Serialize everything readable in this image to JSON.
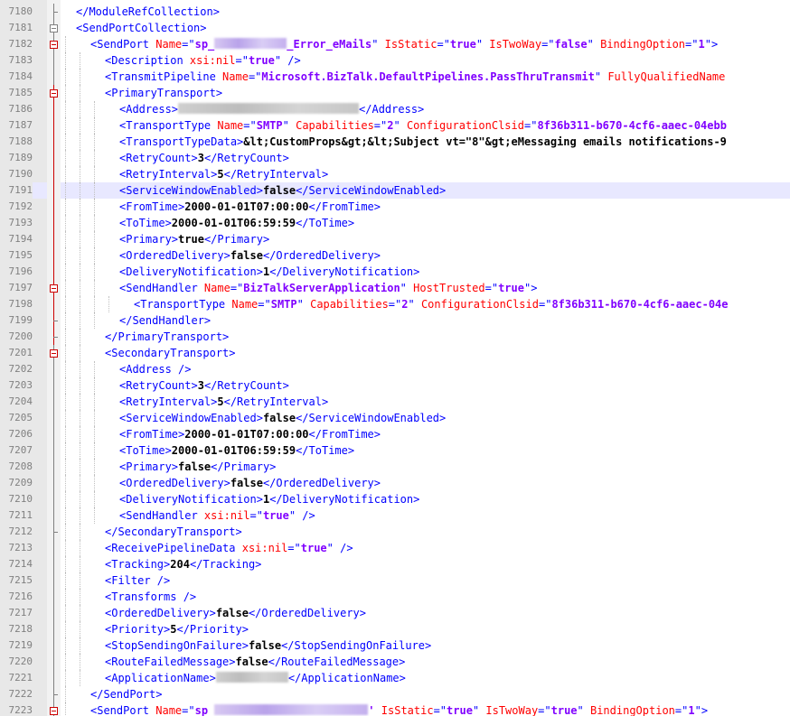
{
  "editor": {
    "colors": {
      "tag": "#0000ff",
      "attr_name": "#ff0000",
      "attr_value": "#8000ff",
      "text": "#000000",
      "line_number": "#808080",
      "current_line_bg": "#e8e8ff"
    },
    "current_line": 7191,
    "lines": [
      {
        "n": "7180",
        "indent": 1,
        "fold": "line",
        "tokens": [
          {
            "t": "tb",
            "v": "</ModuleRefCollection>"
          }
        ]
      },
      {
        "n": "7181",
        "indent": 1,
        "fold": "box",
        "tokens": [
          {
            "t": "tb",
            "v": "<SendPortCollection>"
          }
        ]
      },
      {
        "n": "7182",
        "indent": 2,
        "fold": "box",
        "tokens": [
          {
            "t": "tb",
            "v": "<SendPort "
          },
          {
            "t": "an",
            "v": "Name"
          },
          {
            "t": "tb",
            "v": "=\""
          },
          {
            "t": "av",
            "v": "sp_"
          },
          {
            "t": "blur",
            "w": 80
          },
          {
            "t": "av",
            "v": "_Error_eMails"
          },
          {
            "t": "tb",
            "v": "\" "
          },
          {
            "t": "an",
            "v": "IsStatic"
          },
          {
            "t": "tb",
            "v": "=\""
          },
          {
            "t": "av",
            "v": "true"
          },
          {
            "t": "tb",
            "v": "\" "
          },
          {
            "t": "an",
            "v": "IsTwoWay"
          },
          {
            "t": "tb",
            "v": "=\""
          },
          {
            "t": "av",
            "v": "false"
          },
          {
            "t": "tb",
            "v": "\" "
          },
          {
            "t": "an",
            "v": "BindingOption"
          },
          {
            "t": "tb",
            "v": "=\""
          },
          {
            "t": "av",
            "v": "1"
          },
          {
            "t": "tb",
            "v": "\">"
          }
        ]
      },
      {
        "n": "7183",
        "indent": 3,
        "fold": "line",
        "tokens": [
          {
            "t": "tb",
            "v": "<Description "
          },
          {
            "t": "an",
            "v": "xsi:nil"
          },
          {
            "t": "tb",
            "v": "=\""
          },
          {
            "t": "av",
            "v": "true"
          },
          {
            "t": "tb",
            "v": "\" />"
          }
        ]
      },
      {
        "n": "7184",
        "indent": 3,
        "fold": "line",
        "tokens": [
          {
            "t": "tb",
            "v": "<TransmitPipeline "
          },
          {
            "t": "an",
            "v": "Name"
          },
          {
            "t": "tb",
            "v": "=\""
          },
          {
            "t": "av",
            "v": "Microsoft.BizTalk.DefaultPipelines.PassThruTransmit"
          },
          {
            "t": "tb",
            "v": "\" "
          },
          {
            "t": "an",
            "v": "FullyQualifiedName"
          }
        ]
      },
      {
        "n": "7185",
        "indent": 3,
        "fold": "box",
        "tokens": [
          {
            "t": "tb",
            "v": "<PrimaryTransport>"
          }
        ]
      },
      {
        "n": "7186",
        "indent": 4,
        "fold": "line",
        "tokens": [
          {
            "t": "tb",
            "v": "<Address>"
          },
          {
            "t": "blurg",
            "w": 200
          },
          {
            "t": "tb",
            "v": "</Address>"
          }
        ]
      },
      {
        "n": "7187",
        "indent": 4,
        "fold": "line",
        "tokens": [
          {
            "t": "tb",
            "v": "<TransportType "
          },
          {
            "t": "an",
            "v": "Name"
          },
          {
            "t": "tb",
            "v": "=\""
          },
          {
            "t": "av",
            "v": "SMTP"
          },
          {
            "t": "tb",
            "v": "\" "
          },
          {
            "t": "an",
            "v": "Capabilities"
          },
          {
            "t": "tb",
            "v": "=\""
          },
          {
            "t": "av",
            "v": "2"
          },
          {
            "t": "tb",
            "v": "\" "
          },
          {
            "t": "an",
            "v": "ConfigurationClsid"
          },
          {
            "t": "tb",
            "v": "=\""
          },
          {
            "t": "av",
            "v": "8f36b311-b670-4cf6-aaec-04ebb"
          }
        ]
      },
      {
        "n": "7188",
        "indent": 4,
        "fold": "line",
        "tokens": [
          {
            "t": "tb",
            "v": "<TransportTypeData>"
          },
          {
            "t": "tx",
            "v": "&lt;CustomProps&gt;&lt;Subject vt=\"8\"&gt;eMessaging emails notifications-9"
          }
        ]
      },
      {
        "n": "7189",
        "indent": 4,
        "fold": "line",
        "tokens": [
          {
            "t": "tb",
            "v": "<RetryCount>"
          },
          {
            "t": "tx",
            "v": "3"
          },
          {
            "t": "tb",
            "v": "</RetryCount>"
          }
        ]
      },
      {
        "n": "7190",
        "indent": 4,
        "fold": "line",
        "tokens": [
          {
            "t": "tb",
            "v": "<RetryInterval>"
          },
          {
            "t": "tx",
            "v": "5"
          },
          {
            "t": "tb",
            "v": "</RetryInterval>"
          }
        ]
      },
      {
        "n": "7191",
        "indent": 4,
        "fold": "line",
        "tokens": [
          {
            "t": "tb",
            "v": "<ServiceWindowEnabled>"
          },
          {
            "t": "tx",
            "v": "false"
          },
          {
            "t": "tb",
            "v": "</ServiceWindowEnabled>"
          }
        ]
      },
      {
        "n": "7192",
        "indent": 4,
        "fold": "line",
        "tokens": [
          {
            "t": "tb",
            "v": "<FromTime>"
          },
          {
            "t": "tx",
            "v": "2000-01-01T07:00:00"
          },
          {
            "t": "tb",
            "v": "</FromTime>"
          }
        ]
      },
      {
        "n": "7193",
        "indent": 4,
        "fold": "line",
        "tokens": [
          {
            "t": "tb",
            "v": "<ToTime>"
          },
          {
            "t": "tx",
            "v": "2000-01-01T06:59:59"
          },
          {
            "t": "tb",
            "v": "</ToTime>"
          }
        ]
      },
      {
        "n": "7194",
        "indent": 4,
        "fold": "line",
        "tokens": [
          {
            "t": "tb",
            "v": "<Primary>"
          },
          {
            "t": "tx",
            "v": "true"
          },
          {
            "t": "tb",
            "v": "</Primary>"
          }
        ]
      },
      {
        "n": "7195",
        "indent": 4,
        "fold": "line",
        "tokens": [
          {
            "t": "tb",
            "v": "<OrderedDelivery>"
          },
          {
            "t": "tx",
            "v": "false"
          },
          {
            "t": "tb",
            "v": "</OrderedDelivery>"
          }
        ]
      },
      {
        "n": "7196",
        "indent": 4,
        "fold": "line",
        "tokens": [
          {
            "t": "tb",
            "v": "<DeliveryNotification>"
          },
          {
            "t": "tx",
            "v": "1"
          },
          {
            "t": "tb",
            "v": "</DeliveryNotification>"
          }
        ]
      },
      {
        "n": "7197",
        "indent": 4,
        "fold": "box",
        "tokens": [
          {
            "t": "tb",
            "v": "<SendHandler "
          },
          {
            "t": "an",
            "v": "Name"
          },
          {
            "t": "tb",
            "v": "=\""
          },
          {
            "t": "av",
            "v": "BizTalkServerApplication"
          },
          {
            "t": "tb",
            "v": "\" "
          },
          {
            "t": "an",
            "v": "HostTrusted"
          },
          {
            "t": "tb",
            "v": "=\""
          },
          {
            "t": "av",
            "v": "true"
          },
          {
            "t": "tb",
            "v": "\">"
          }
        ]
      },
      {
        "n": "7198",
        "indent": 5,
        "fold": "line",
        "tokens": [
          {
            "t": "tb",
            "v": "<TransportType "
          },
          {
            "t": "an",
            "v": "Name"
          },
          {
            "t": "tb",
            "v": "=\""
          },
          {
            "t": "av",
            "v": "SMTP"
          },
          {
            "t": "tb",
            "v": "\" "
          },
          {
            "t": "an",
            "v": "Capabilities"
          },
          {
            "t": "tb",
            "v": "=\""
          },
          {
            "t": "av",
            "v": "2"
          },
          {
            "t": "tb",
            "v": "\" "
          },
          {
            "t": "an",
            "v": "ConfigurationClsid"
          },
          {
            "t": "tb",
            "v": "=\""
          },
          {
            "t": "av",
            "v": "8f36b311-b670-4cf6-aaec-04e"
          }
        ]
      },
      {
        "n": "7199",
        "indent": 4,
        "fold": "line",
        "tokens": [
          {
            "t": "tb",
            "v": "</SendHandler>"
          }
        ]
      },
      {
        "n": "7200",
        "indent": 3,
        "fold": "line",
        "tokens": [
          {
            "t": "tb",
            "v": "</PrimaryTransport>"
          }
        ]
      },
      {
        "n": "7201",
        "indent": 3,
        "fold": "box",
        "tokens": [
          {
            "t": "tb",
            "v": "<SecondaryTransport>"
          }
        ]
      },
      {
        "n": "7202",
        "indent": 4,
        "fold": "line",
        "tokens": [
          {
            "t": "tb",
            "v": "<Address />"
          }
        ]
      },
      {
        "n": "7203",
        "indent": 4,
        "fold": "line",
        "tokens": [
          {
            "t": "tb",
            "v": "<RetryCount>"
          },
          {
            "t": "tx",
            "v": "3"
          },
          {
            "t": "tb",
            "v": "</RetryCount>"
          }
        ]
      },
      {
        "n": "7204",
        "indent": 4,
        "fold": "line",
        "tokens": [
          {
            "t": "tb",
            "v": "<RetryInterval>"
          },
          {
            "t": "tx",
            "v": "5"
          },
          {
            "t": "tb",
            "v": "</RetryInterval>"
          }
        ]
      },
      {
        "n": "7205",
        "indent": 4,
        "fold": "line",
        "tokens": [
          {
            "t": "tb",
            "v": "<ServiceWindowEnabled>"
          },
          {
            "t": "tx",
            "v": "false"
          },
          {
            "t": "tb",
            "v": "</ServiceWindowEnabled>"
          }
        ]
      },
      {
        "n": "7206",
        "indent": 4,
        "fold": "line",
        "tokens": [
          {
            "t": "tb",
            "v": "<FromTime>"
          },
          {
            "t": "tx",
            "v": "2000-01-01T07:00:00"
          },
          {
            "t": "tb",
            "v": "</FromTime>"
          }
        ]
      },
      {
        "n": "7207",
        "indent": 4,
        "fold": "line",
        "tokens": [
          {
            "t": "tb",
            "v": "<ToTime>"
          },
          {
            "t": "tx",
            "v": "2000-01-01T06:59:59"
          },
          {
            "t": "tb",
            "v": "</ToTime>"
          }
        ]
      },
      {
        "n": "7208",
        "indent": 4,
        "fold": "line",
        "tokens": [
          {
            "t": "tb",
            "v": "<Primary>"
          },
          {
            "t": "tx",
            "v": "false"
          },
          {
            "t": "tb",
            "v": "</Primary>"
          }
        ]
      },
      {
        "n": "7209",
        "indent": 4,
        "fold": "line",
        "tokens": [
          {
            "t": "tb",
            "v": "<OrderedDelivery>"
          },
          {
            "t": "tx",
            "v": "false"
          },
          {
            "t": "tb",
            "v": "</OrderedDelivery>"
          }
        ]
      },
      {
        "n": "7210",
        "indent": 4,
        "fold": "line",
        "tokens": [
          {
            "t": "tb",
            "v": "<DeliveryNotification>"
          },
          {
            "t": "tx",
            "v": "1"
          },
          {
            "t": "tb",
            "v": "</DeliveryNotification>"
          }
        ]
      },
      {
        "n": "7211",
        "indent": 4,
        "fold": "line",
        "tokens": [
          {
            "t": "tb",
            "v": "<SendHandler "
          },
          {
            "t": "an",
            "v": "xsi:nil"
          },
          {
            "t": "tb",
            "v": "=\""
          },
          {
            "t": "av",
            "v": "true"
          },
          {
            "t": "tb",
            "v": "\" />"
          }
        ]
      },
      {
        "n": "7212",
        "indent": 3,
        "fold": "line",
        "tokens": [
          {
            "t": "tb",
            "v": "</SecondaryTransport>"
          }
        ]
      },
      {
        "n": "7213",
        "indent": 3,
        "fold": "line",
        "tokens": [
          {
            "t": "tb",
            "v": "<ReceivePipelineData "
          },
          {
            "t": "an",
            "v": "xsi:nil"
          },
          {
            "t": "tb",
            "v": "=\""
          },
          {
            "t": "av",
            "v": "true"
          },
          {
            "t": "tb",
            "v": "\" />"
          }
        ]
      },
      {
        "n": "7214",
        "indent": 3,
        "fold": "line",
        "tokens": [
          {
            "t": "tb",
            "v": "<Tracking>"
          },
          {
            "t": "tx",
            "v": "204"
          },
          {
            "t": "tb",
            "v": "</Tracking>"
          }
        ]
      },
      {
        "n": "7215",
        "indent": 3,
        "fold": "line",
        "tokens": [
          {
            "t": "tb",
            "v": "<Filter />"
          }
        ]
      },
      {
        "n": "7216",
        "indent": 3,
        "fold": "line",
        "tokens": [
          {
            "t": "tb",
            "v": "<Transforms />"
          }
        ]
      },
      {
        "n": "7217",
        "indent": 3,
        "fold": "line",
        "tokens": [
          {
            "t": "tb",
            "v": "<OrderedDelivery>"
          },
          {
            "t": "tx",
            "v": "false"
          },
          {
            "t": "tb",
            "v": "</OrderedDelivery>"
          }
        ]
      },
      {
        "n": "7218",
        "indent": 3,
        "fold": "line",
        "tokens": [
          {
            "t": "tb",
            "v": "<Priority>"
          },
          {
            "t": "tx",
            "v": "5"
          },
          {
            "t": "tb",
            "v": "</Priority>"
          }
        ]
      },
      {
        "n": "7219",
        "indent": 3,
        "fold": "line",
        "tokens": [
          {
            "t": "tb",
            "v": "<StopSendingOnFailure>"
          },
          {
            "t": "tx",
            "v": "false"
          },
          {
            "t": "tb",
            "v": "</StopSendingOnFailure>"
          }
        ]
      },
      {
        "n": "7220",
        "indent": 3,
        "fold": "line",
        "tokens": [
          {
            "t": "tb",
            "v": "<RouteFailedMessage>"
          },
          {
            "t": "tx",
            "v": "false"
          },
          {
            "t": "tb",
            "v": "</RouteFailedMessage>"
          }
        ]
      },
      {
        "n": "7221",
        "indent": 3,
        "fold": "line",
        "tokens": [
          {
            "t": "tb",
            "v": "<ApplicationName>"
          },
          {
            "t": "blurg",
            "w": 80
          },
          {
            "t": "tb",
            "v": "</ApplicationName>"
          }
        ]
      },
      {
        "n": "7222",
        "indent": 2,
        "fold": "line",
        "tokens": [
          {
            "t": "tb",
            "v": "</SendPort>"
          }
        ]
      },
      {
        "n": "7223",
        "indent": 2,
        "fold": "box",
        "tokens": [
          {
            "t": "tb",
            "v": "<SendPort "
          },
          {
            "t": "an",
            "v": "Name"
          },
          {
            "t": "tb",
            "v": "=\""
          },
          {
            "t": "av",
            "v": "sp "
          },
          {
            "t": "blur",
            "w": 170
          },
          {
            "t": "av",
            "v": "'"
          },
          {
            "t": "tb",
            "v": " "
          },
          {
            "t": "an",
            "v": "IsStatic"
          },
          {
            "t": "tb",
            "v": "=\""
          },
          {
            "t": "av",
            "v": "true"
          },
          {
            "t": "tb",
            "v": "\" "
          },
          {
            "t": "an",
            "v": "IsTwoWay"
          },
          {
            "t": "tb",
            "v": "=\""
          },
          {
            "t": "av",
            "v": "true"
          },
          {
            "t": "tb",
            "v": "\" "
          },
          {
            "t": "an",
            "v": "BindingOption"
          },
          {
            "t": "tb",
            "v": "=\""
          },
          {
            "t": "av",
            "v": "1"
          },
          {
            "t": "tb",
            "v": "\">"
          }
        ]
      }
    ]
  }
}
